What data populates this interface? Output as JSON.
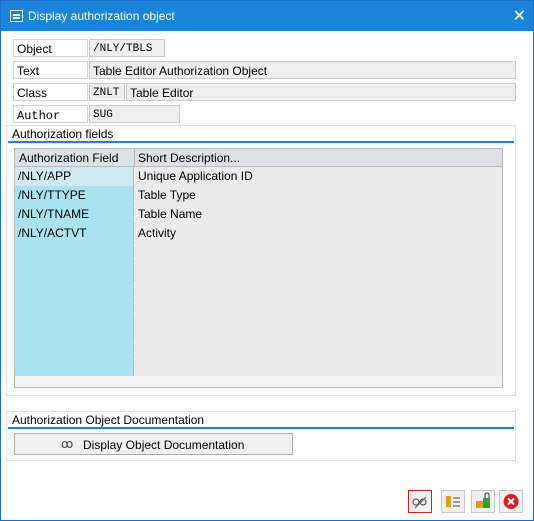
{
  "window": {
    "title": "Display authorization object"
  },
  "header": {
    "object_label": "Object",
    "object_value": "/NLY/TBLS",
    "text_label": "Text",
    "text_value": "Table Editor Authorization Object",
    "class_label": "Class",
    "class_code": "ZNLT",
    "class_desc": "Table Editor",
    "author_label": "Author",
    "author_value": "SUG"
  },
  "auth_fields": {
    "group_title": "Authorization fields",
    "columns": [
      "Authorization Field",
      "Short Description..."
    ],
    "rows": [
      [
        "/NLY/APP",
        "Unique Application ID"
      ],
      [
        "/NLY/TTYPE",
        "Table Type"
      ],
      [
        "/NLY/TNAME",
        "Table Name"
      ],
      [
        "/NLY/ACTVT",
        "Activity"
      ]
    ]
  },
  "documentation": {
    "group_title": "Authorization Object Documentation",
    "button_label": "Display Object Documentation"
  },
  "toolbar": {
    "icons": [
      "glasses-edit-icon",
      "where-used-icon",
      "transport-lock-icon",
      "cancel-icon"
    ],
    "colors": {
      "title_bar": "#1a84da",
      "field_cell": "#a8e3ef",
      "cancel": "#d92020"
    }
  }
}
